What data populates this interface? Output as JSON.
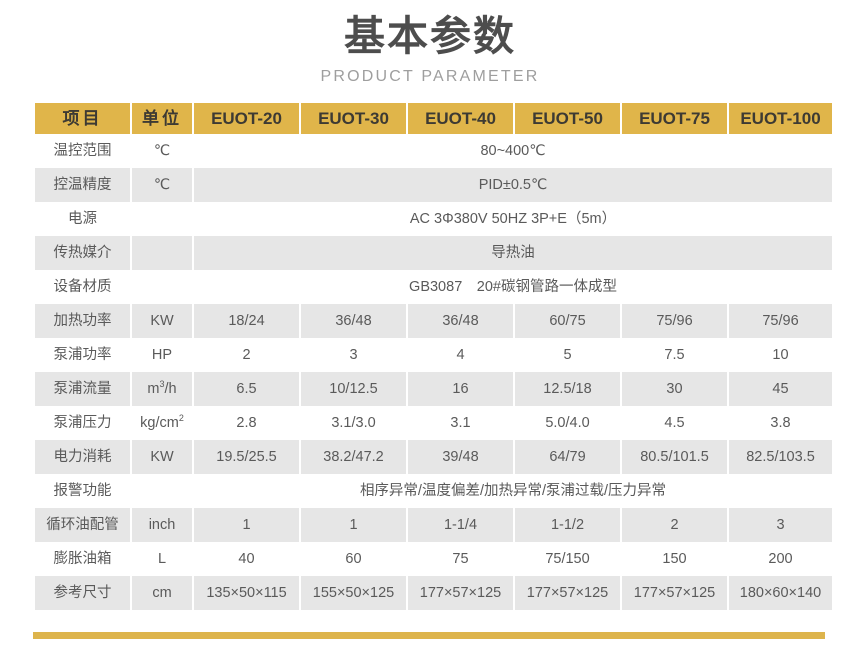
{
  "header": {
    "title": "基本参数",
    "subtitle": "PRODUCT PARAMETER"
  },
  "colors": {
    "header_gold": "#e0b54a",
    "accent_bar": "#ddb44c",
    "row_shaded": "#e6e6e6",
    "title_text": "#4d4d4d",
    "subtitle_text": "#9e9e9e",
    "body_text": "#5a5a5a"
  },
  "table": {
    "columns": [
      "项目",
      "单位",
      "EUOT-20",
      "EUOT-30",
      "EUOT-40",
      "EUOT-50",
      "EUOT-75",
      "EUOT-100"
    ],
    "rows": [
      {
        "item": "温控范围",
        "unit": "℃",
        "merged": true,
        "merged_value": "80~400℃",
        "shaded": false
      },
      {
        "item": "控温精度",
        "unit": "℃",
        "merged": true,
        "merged_value": "PID±0.5℃",
        "shaded": true
      },
      {
        "item": "电源",
        "unit": "",
        "merged": true,
        "merged_value": "AC 3Φ380V 50HZ  3P+E（5m）",
        "shaded": false
      },
      {
        "item": "传热媒介",
        "unit": "",
        "merged": true,
        "merged_value": "导热油",
        "shaded": true
      },
      {
        "item": "设备材质",
        "unit": "",
        "merged": true,
        "merged_value": "GB3087　20#碳钢管路一体成型",
        "shaded": false
      },
      {
        "item": "加热功率",
        "unit": "KW",
        "merged": false,
        "values": [
          "18/24",
          "36/48",
          "36/48",
          "60/75",
          "75/96",
          "75/96"
        ],
        "shaded": true
      },
      {
        "item": "泵浦功率",
        "unit": "HP",
        "merged": false,
        "values": [
          "2",
          "3",
          "4",
          "5",
          "7.5",
          "10"
        ],
        "shaded": false
      },
      {
        "item": "泵浦流量",
        "unit": "m³/h",
        "unit_html": "m<sup>3</sup>/h",
        "merged": false,
        "values": [
          "6.5",
          "10/12.5",
          "16",
          "12.5/18",
          "30",
          "45"
        ],
        "shaded": true
      },
      {
        "item": "泵浦压力",
        "unit": "kg/cm²",
        "unit_html": "kg/cm<sup>2</sup>",
        "merged": false,
        "values": [
          "2.8",
          "3.1/3.0",
          "3.1",
          "5.0/4.0",
          "4.5",
          "3.8"
        ],
        "shaded": false
      },
      {
        "item": "电力消耗",
        "unit": "KW",
        "merged": false,
        "values": [
          "19.5/25.5",
          "38.2/47.2",
          "39/48",
          "64/79",
          "80.5/101.5",
          "82.5/103.5"
        ],
        "shaded": true
      },
      {
        "item": "报警功能",
        "unit": "",
        "merged": true,
        "merged_value": "相序异常/温度偏差/加热异常/泵浦过载/压力异常",
        "shaded": false
      },
      {
        "item": "循环油配管",
        "unit": "inch",
        "merged": false,
        "values": [
          "1",
          "1",
          "1-1/4",
          "1-1/2",
          "2",
          "3"
        ],
        "shaded": true
      },
      {
        "item": "膨胀油箱",
        "unit": "L",
        "merged": false,
        "values": [
          "40",
          "60",
          "75",
          "75/150",
          "150",
          "200"
        ],
        "shaded": false
      },
      {
        "item": "参考尺寸",
        "unit": "cm",
        "merged": false,
        "values": [
          "135×50×115",
          "155×50×125",
          "177×57×125",
          "177×57×125",
          "177×57×125",
          "180×60×140"
        ],
        "shaded": true
      }
    ]
  }
}
